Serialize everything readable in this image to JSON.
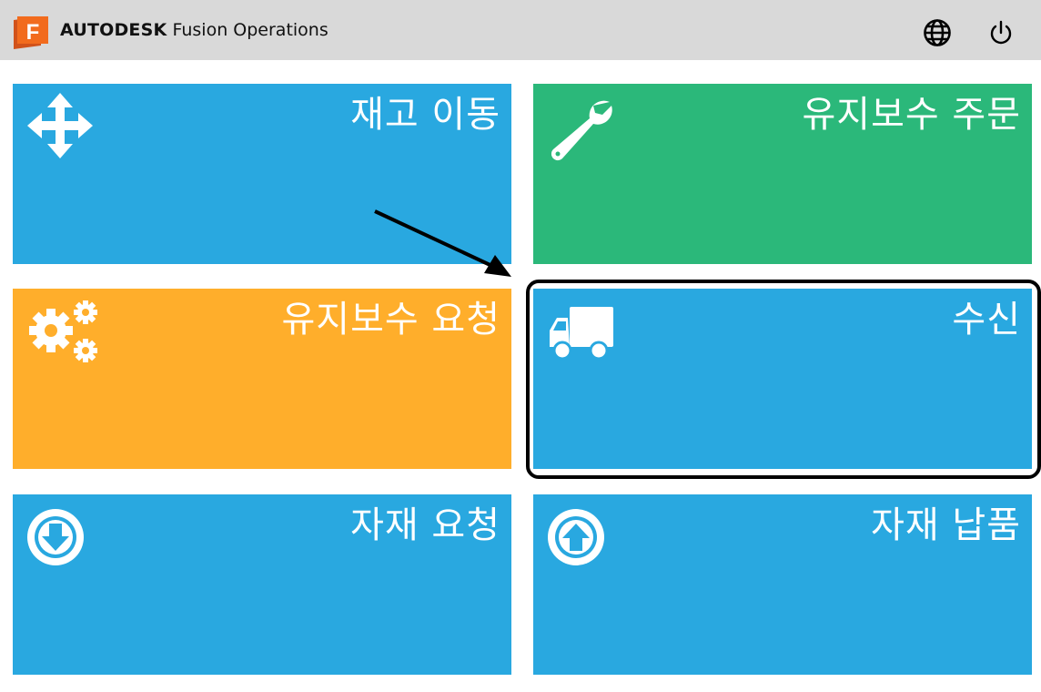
{
  "header": {
    "logo_letter": "F",
    "brand_bold": "AUTODESK",
    "brand_product": "Fusion Operations",
    "icons": [
      "globe-icon",
      "power-icon"
    ]
  },
  "tiles": [
    {
      "label": "재고 이동",
      "icon": "move-arrows-icon",
      "color": "#29a8e0"
    },
    {
      "label": "유지보수 주문",
      "icon": "wrench-icon",
      "color": "#2bb87a"
    },
    {
      "label": "유지보수 요청",
      "icon": "gears-icon",
      "color": "#ffae2b"
    },
    {
      "label": "수신",
      "icon": "truck-icon",
      "color": "#29a8e0"
    },
    {
      "label": "자재 요청",
      "icon": "arrow-down-circle-icon",
      "color": "#29a8e0"
    },
    {
      "label": "자재 납품",
      "icon": "arrow-up-circle-icon",
      "color": "#29a8e0"
    }
  ],
  "colors": {
    "topbar": "#d9d9d9",
    "blue": "#29a8e0",
    "green": "#2bb87a",
    "orange": "#ffae2b",
    "logo": "#f26b1d"
  }
}
